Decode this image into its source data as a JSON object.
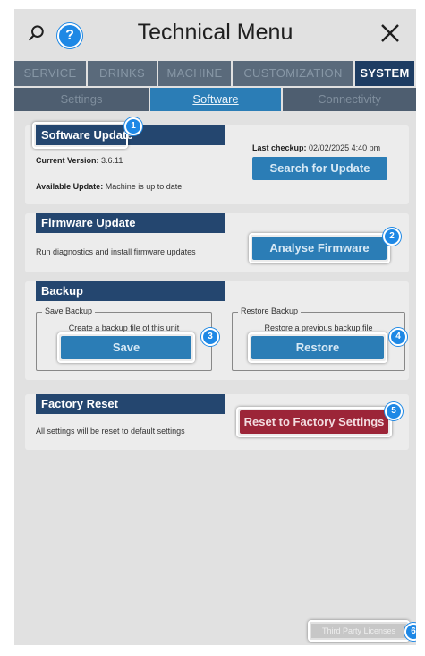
{
  "header": {
    "title": "Technical Menu",
    "help_label": "?"
  },
  "tabs": [
    "SERVICE",
    "DRINKS",
    "MACHINE",
    "CUSTOMIZATION",
    "SYSTEM"
  ],
  "active_tab": "SYSTEM",
  "subtabs": [
    "Settings",
    "Software",
    "Connectivity"
  ],
  "active_subtab": "Software",
  "software_update": {
    "title": "Software Update",
    "current_version_label": "Current Version:",
    "current_version": "3.6.11",
    "available_update_label": "Available Update:",
    "available_update": "Machine is up to date",
    "last_checkup_label": "Last checkup:",
    "last_checkup": "02/02/2025 4:40 pm",
    "button": "Search for Update"
  },
  "firmware_update": {
    "title": "Firmware Update",
    "description": "Run diagnostics and install firmware updates",
    "button": "Analyse Firmware"
  },
  "backup": {
    "title": "Backup",
    "save_group": "Save Backup",
    "save_text": "Create a backup file of this unit",
    "save_button": "Save",
    "restore_group": "Restore Backup",
    "restore_text": "Restore a previous backup file",
    "restore_button": "Restore"
  },
  "factory_reset": {
    "title": "Factory Reset",
    "description": "All settings will be reset to default settings",
    "button": "Reset to Factory Settings"
  },
  "footer": {
    "licenses": "Third Party Licenses"
  },
  "badges": [
    "1",
    "2",
    "3",
    "4",
    "5",
    "6"
  ],
  "colors": {
    "accent": "#2b7db6",
    "header_bar": "#24466f",
    "danger": "#9c2538",
    "badge": "#1e88e5"
  }
}
